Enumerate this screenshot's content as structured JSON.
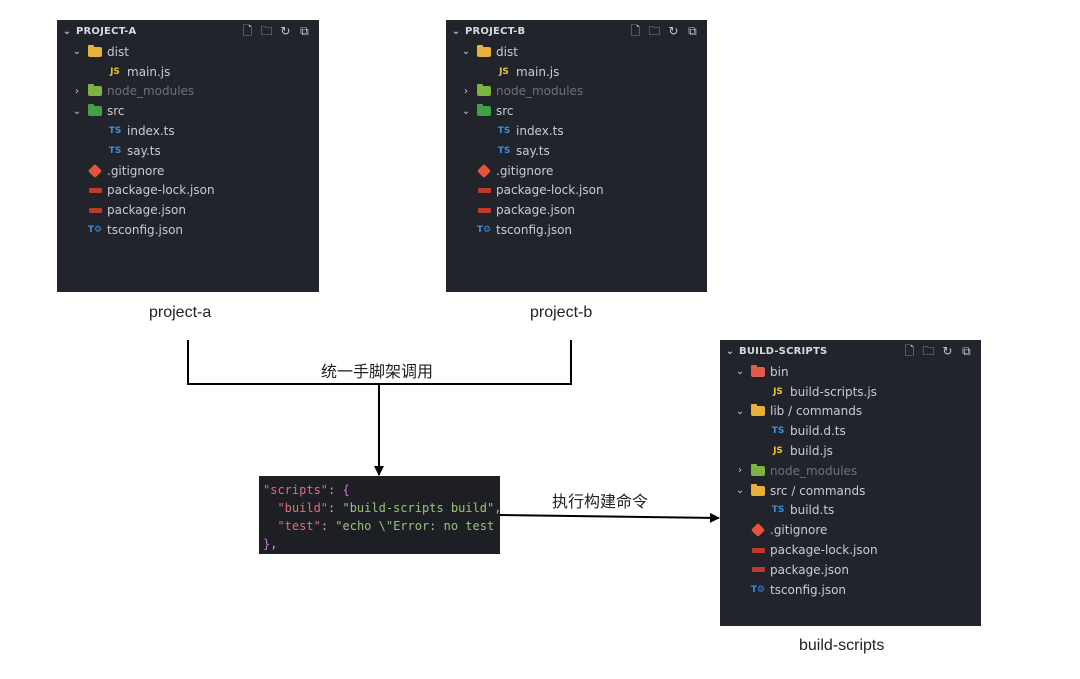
{
  "panels": {
    "a": {
      "title": "PROJECT-A",
      "items": [
        {
          "toggle": "⌄",
          "icon": "folder-dist",
          "name": "dist",
          "indent": 0
        },
        {
          "toggle": "",
          "icon": "js",
          "name": "main.js",
          "indent": 1
        },
        {
          "toggle": "›",
          "icon": "folder-node",
          "name": "node_modules",
          "indent": 0,
          "dim": true
        },
        {
          "toggle": "⌄",
          "icon": "folder-src",
          "name": "src",
          "indent": 0
        },
        {
          "toggle": "",
          "icon": "ts",
          "name": "index.ts",
          "indent": 1
        },
        {
          "toggle": "",
          "icon": "ts",
          "name": "say.ts",
          "indent": 1
        },
        {
          "toggle": "",
          "icon": "git",
          "name": ".gitignore",
          "indent": 0
        },
        {
          "toggle": "",
          "icon": "npm",
          "name": "package-lock.json",
          "indent": 0
        },
        {
          "toggle": "",
          "icon": "npm",
          "name": "package.json",
          "indent": 0
        },
        {
          "toggle": "",
          "icon": "tsconfig",
          "name": "tsconfig.json",
          "indent": 0
        }
      ]
    },
    "b": {
      "title": "PROJECT-B",
      "items": [
        {
          "toggle": "⌄",
          "icon": "folder-dist",
          "name": "dist",
          "indent": 0
        },
        {
          "toggle": "",
          "icon": "js",
          "name": "main.js",
          "indent": 1
        },
        {
          "toggle": "›",
          "icon": "folder-node",
          "name": "node_modules",
          "indent": 0,
          "dim": true
        },
        {
          "toggle": "⌄",
          "icon": "folder-src",
          "name": "src",
          "indent": 0
        },
        {
          "toggle": "",
          "icon": "ts",
          "name": "index.ts",
          "indent": 1
        },
        {
          "toggle": "",
          "icon": "ts",
          "name": "say.ts",
          "indent": 1
        },
        {
          "toggle": "",
          "icon": "git",
          "name": ".gitignore",
          "indent": 0
        },
        {
          "toggle": "",
          "icon": "npm",
          "name": "package-lock.json",
          "indent": 0
        },
        {
          "toggle": "",
          "icon": "npm",
          "name": "package.json",
          "indent": 0
        },
        {
          "toggle": "",
          "icon": "tsconfig",
          "name": "tsconfig.json",
          "indent": 0
        }
      ]
    },
    "c": {
      "title": "BUILD-SCRIPTS",
      "items": [
        {
          "toggle": "⌄",
          "icon": "folder-bin",
          "name": "bin",
          "indent": 0
        },
        {
          "toggle": "",
          "icon": "js",
          "name": "build-scripts.js",
          "indent": 1
        },
        {
          "toggle": "⌄",
          "icon": "folder-lib",
          "name": "lib / commands",
          "indent": 0
        },
        {
          "toggle": "",
          "icon": "ts",
          "name": "build.d.ts",
          "indent": 1
        },
        {
          "toggle": "",
          "icon": "js",
          "name": "build.js",
          "indent": 1
        },
        {
          "toggle": "›",
          "icon": "folder-node",
          "name": "node_modules",
          "indent": 0,
          "dim": true
        },
        {
          "toggle": "⌄",
          "icon": "folder-lib",
          "name": "src / commands",
          "indent": 0
        },
        {
          "toggle": "",
          "icon": "ts",
          "name": "build.ts",
          "indent": 1
        },
        {
          "toggle": "",
          "icon": "git",
          "name": ".gitignore",
          "indent": 0
        },
        {
          "toggle": "",
          "icon": "npm",
          "name": "package-lock.json",
          "indent": 0
        },
        {
          "toggle": "",
          "icon": "npm",
          "name": "package.json",
          "indent": 0
        },
        {
          "toggle": "",
          "icon": "tsconfig",
          "name": "tsconfig.json",
          "indent": 0
        }
      ]
    }
  },
  "header_actions": [
    "new-file-icon",
    "new-folder-icon",
    "refresh-icon",
    "collapse-all-icon"
  ],
  "captions": {
    "a": "project-a",
    "b": "project-b",
    "c": "build-scripts"
  },
  "labels": {
    "merge": "统一手脚架调用",
    "exec": "执行构建命令"
  },
  "code": {
    "line1_key": "\"scripts\"",
    "line2_key": "\"build\"",
    "line2_val": "\"build-scripts build\"",
    "line3_key": "\"test\"",
    "line3_val": "\"echo \\\"Error: no test"
  }
}
